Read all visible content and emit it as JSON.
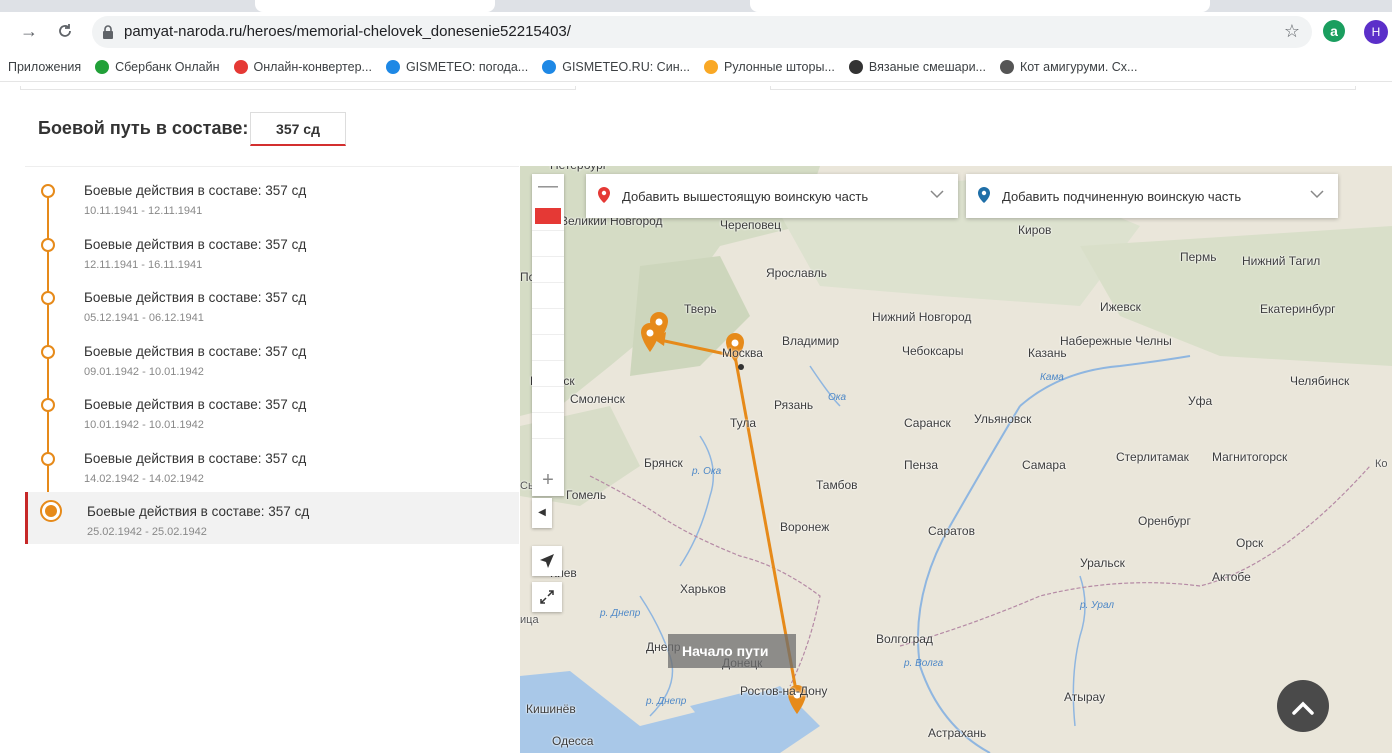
{
  "browser": {
    "url": "pamyat-naroda.ru/heroes/memorial-chelovek_donesenie52215403/",
    "ext_badge": "a",
    "profile_initial": "Н",
    "bookmarks": [
      {
        "label": "Приложения",
        "icon": "apps-icon",
        "color": "#4285f4"
      },
      {
        "label": "Сбербанк Онлайн",
        "icon": "sberbank-icon",
        "color": "#21a038"
      },
      {
        "label": "Онлайн-конвертер...",
        "icon": "converter-icon",
        "color": "#e53935"
      },
      {
        "label": "GISMETEO: погода...",
        "icon": "gismeteo-icon",
        "color": "#1e88e5"
      },
      {
        "label": "GISMETEO.RU: Син...",
        "icon": "gismeteo-icon",
        "color": "#1e88e5"
      },
      {
        "label": "Рулонные шторы...",
        "icon": "blinds-icon",
        "color": "#f9a825"
      },
      {
        "label": "Вязаные смешари...",
        "icon": "m-logo-icon",
        "color": "#333333"
      },
      {
        "label": "Кот амигуруми. Сх...",
        "icon": "globe-icon",
        "color": "#555555"
      }
    ]
  },
  "page": {
    "title": "Боевой путь в составе:",
    "unit": "357 сд"
  },
  "timeline": [
    {
      "title": "Боевые действия в составе: 357 сд",
      "dates": "10.11.1941 - 12.11.1941",
      "active": false
    },
    {
      "title": "Боевые действия в составе: 357 сд",
      "dates": "12.11.1941 - 16.11.1941",
      "active": false
    },
    {
      "title": "Боевые действия в составе: 357 сд",
      "dates": "05.12.1941 - 06.12.1941",
      "active": false
    },
    {
      "title": "Боевые действия в составе: 357 сд",
      "dates": "09.01.1942 - 10.01.1942",
      "active": false
    },
    {
      "title": "Боевые действия в составе: 357 сд",
      "dates": "10.01.1942 - 10.01.1942",
      "active": false
    },
    {
      "title": "Боевые действия в составе: 357 сд",
      "dates": "14.02.1942 - 14.02.1942",
      "active": false
    },
    {
      "title": "Боевые действия в составе: 357 сд",
      "dates": "25.02.1942 - 25.02.1942",
      "active": true
    }
  ],
  "map": {
    "dropdown_parent": "Добавить вышестоящую воинскую часть",
    "dropdown_child": "Добавить подчиненную воинскую часть",
    "start_label": "Начало пути",
    "route_color": "#e68a1a",
    "cities": [
      "Петербург",
      "Великий Новгород",
      "Череповец",
      "Киров",
      "Пермь",
      "Нижний Тагил",
      "Псков",
      "Ярославль",
      "Тверь",
      "Нижний Новгород",
      "Ижевск",
      "Екатеринбург",
      "Владимир",
      "Москва",
      "Чебоксары",
      "Казань",
      "Набережные Челны",
      "Витебск",
      "Смоленск",
      "Рязань",
      "Челябинск",
      "Уфа",
      "Тула",
      "Саранск",
      "Ульяновск",
      "Брянск",
      "Пенза",
      "Самара",
      "Стерлитамак",
      "Магнитогорск",
      "Ко",
      "Сь",
      "Гомель",
      "Тамбов",
      "Воронеж",
      "Саратов",
      "Оренбург",
      "Орск",
      "Уральск",
      "Актобе",
      "Киев",
      "Харьков",
      "ица",
      "Днепр",
      "Донецк",
      "Волгоград",
      "Ростов-на-Дону",
      "Атырау",
      "Кишинёв",
      "Одесса",
      "Астрахань"
    ],
    "rivers": [
      "Кама",
      "Ока",
      "р. Ока",
      "р. Днепр",
      "р. Урал",
      "р. Волга",
      "р. Днепр"
    ]
  }
}
